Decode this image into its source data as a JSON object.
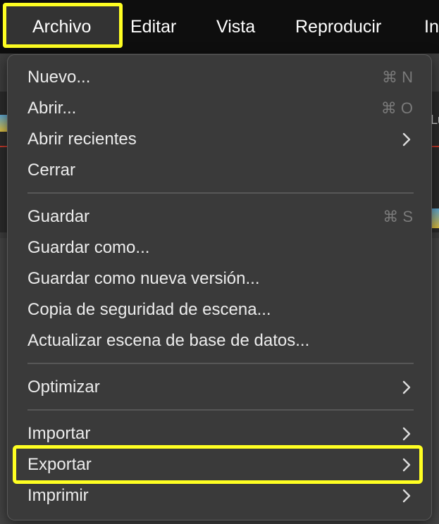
{
  "menubar": {
    "items": [
      {
        "label": "Archivo"
      },
      {
        "label": "Editar"
      },
      {
        "label": "Vista"
      },
      {
        "label": "Reproducir"
      },
      {
        "label": "In"
      }
    ]
  },
  "background": {
    "partial_text": "Lu"
  },
  "menu": {
    "items": [
      {
        "label": "Nuevo...",
        "shortcut": "⌘ N"
      },
      {
        "label": "Abrir...",
        "shortcut": "⌘ O"
      },
      {
        "label": "Abrir recientes",
        "submenu": true
      },
      {
        "label": "Cerrar"
      },
      {
        "label": "Guardar",
        "shortcut": "⌘ S"
      },
      {
        "label": "Guardar como..."
      },
      {
        "label": "Guardar como nueva versión..."
      },
      {
        "label": "Copia de seguridad de escena..."
      },
      {
        "label": "Actualizar escena de base de datos..."
      },
      {
        "label": "Optimizar",
        "submenu": true
      },
      {
        "label": "Importar",
        "submenu": true
      },
      {
        "label": "Exportar",
        "submenu": true
      },
      {
        "label": "Imprimir",
        "submenu": true
      }
    ]
  },
  "colors": {
    "highlight": "#ffff22",
    "menu_bg": "#3a3a3a",
    "menubar_bg": "#0e0e0e"
  }
}
